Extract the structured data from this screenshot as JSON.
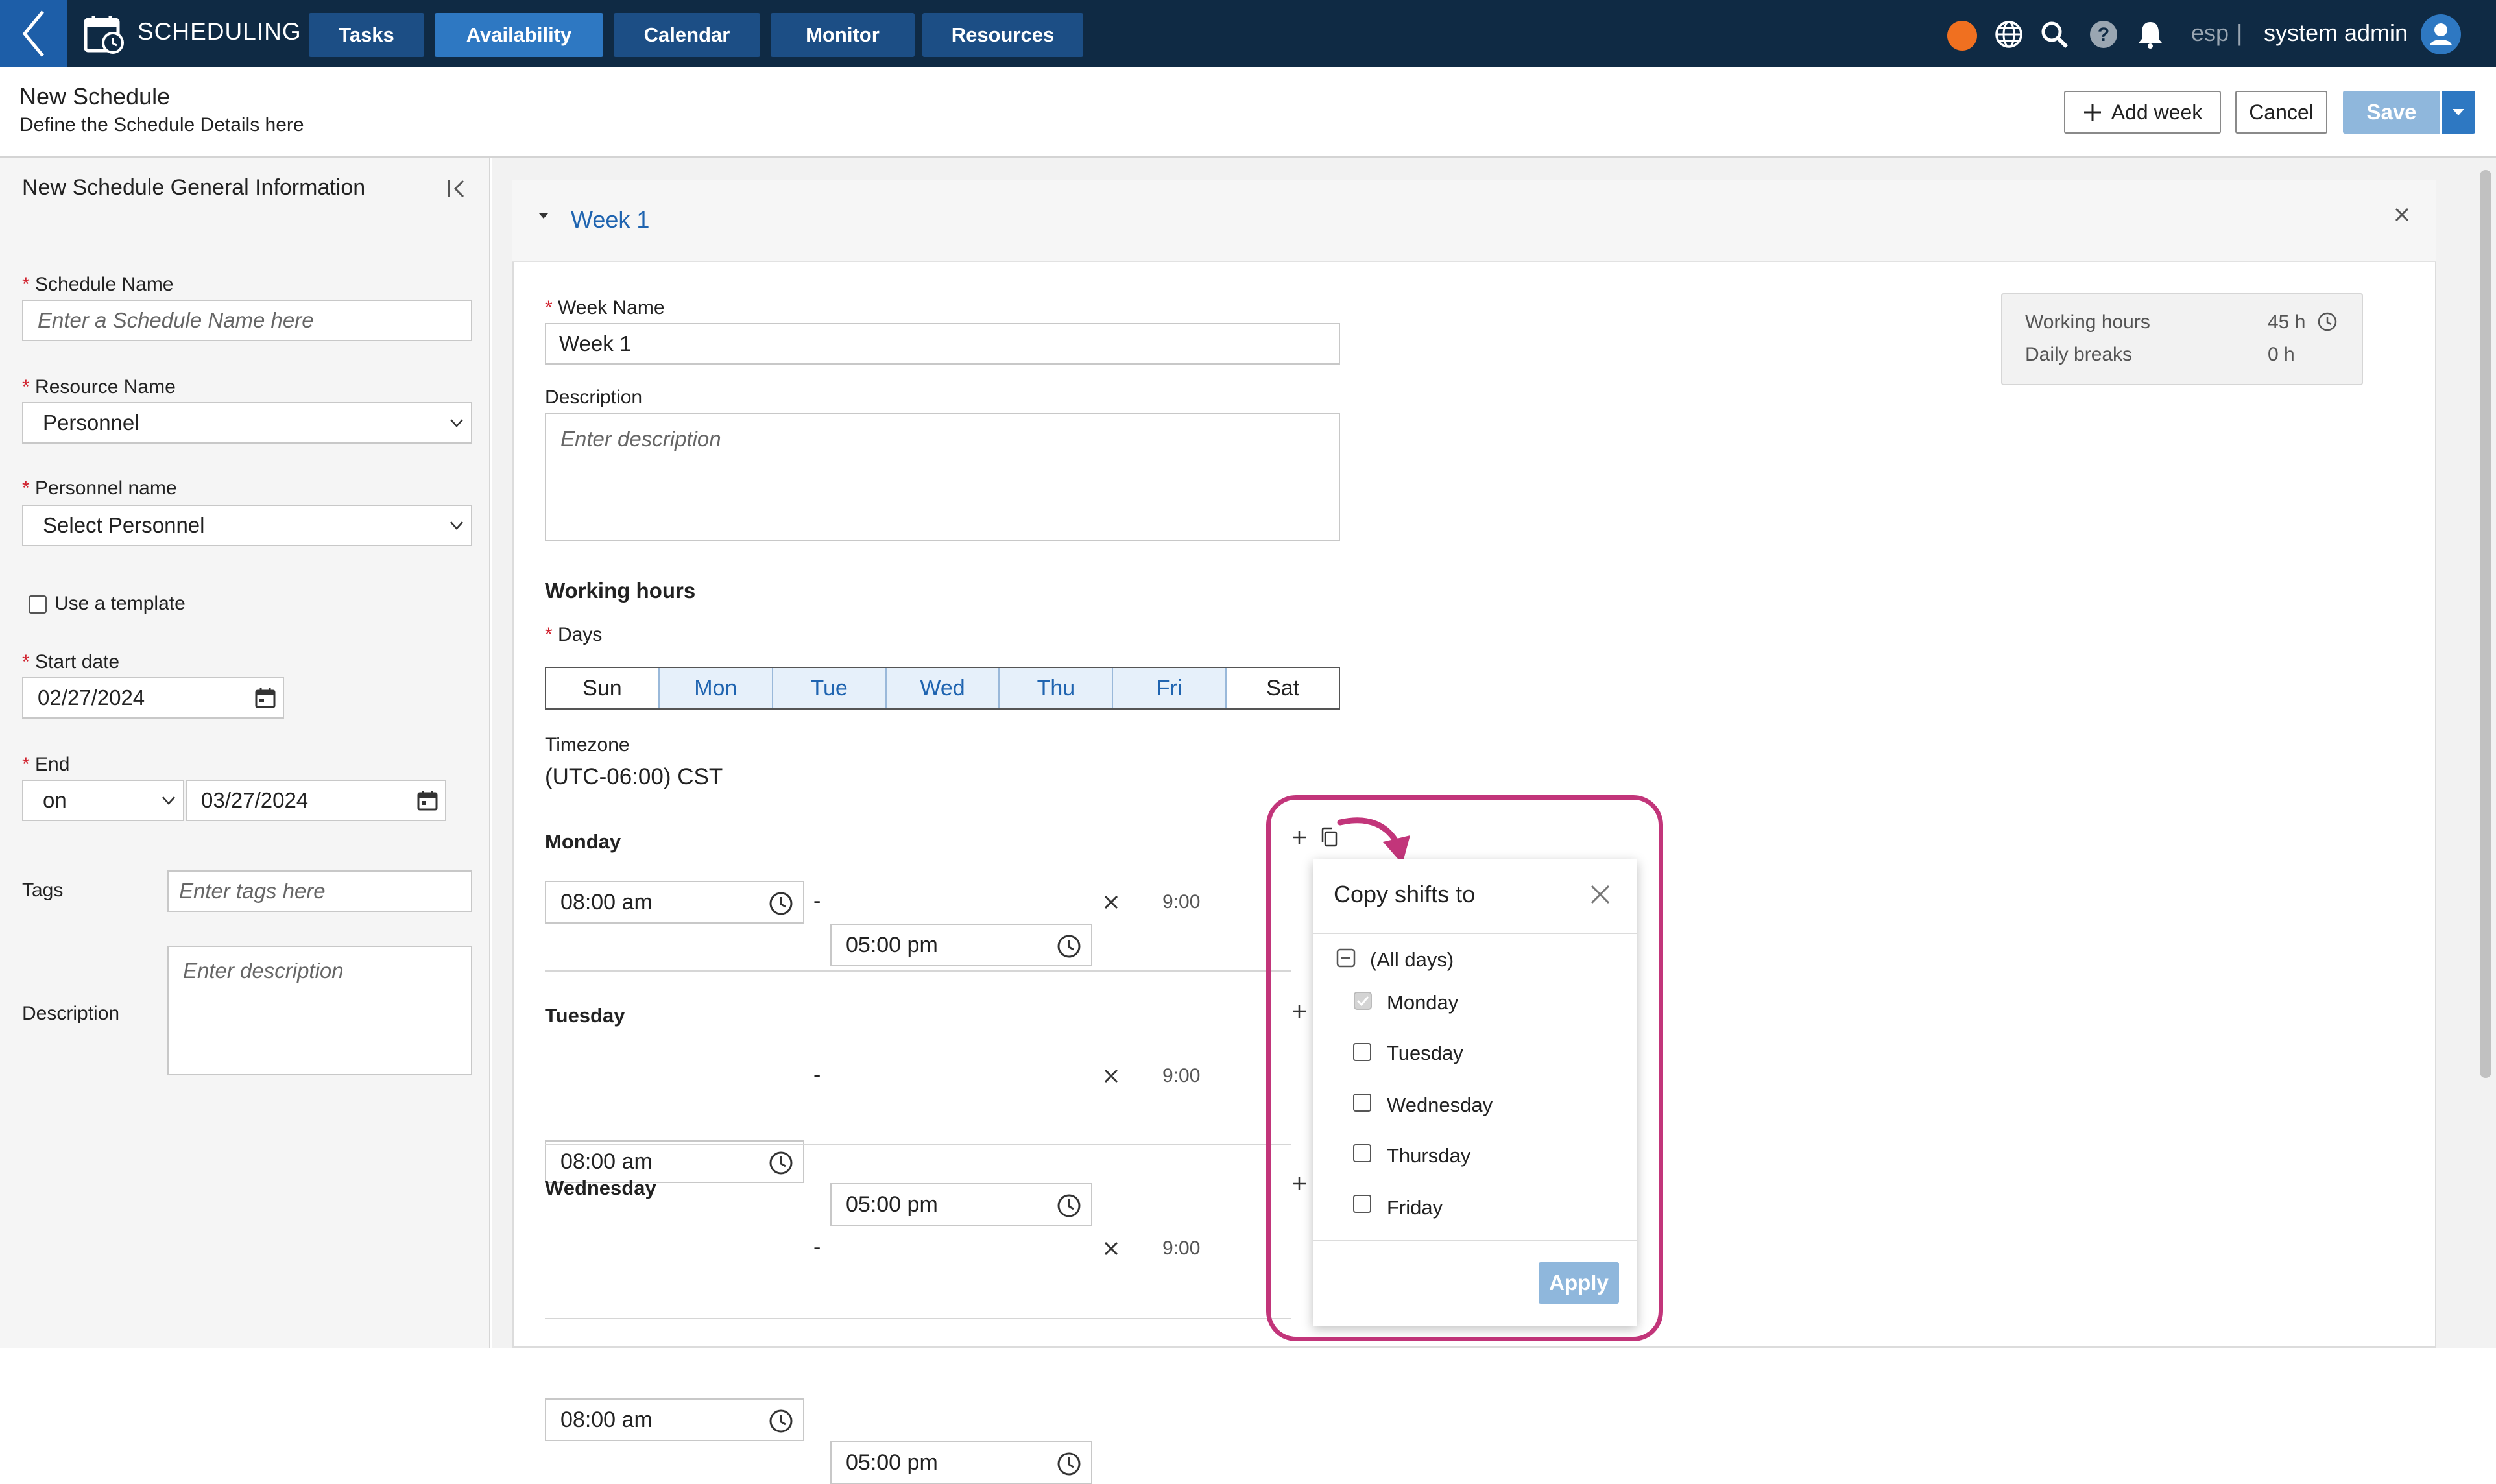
{
  "topbar": {
    "app_title": "SCHEDULING",
    "nav": [
      "Tasks",
      "Availability",
      "Calendar",
      "Monitor",
      "Resources"
    ],
    "active_nav": "Availability",
    "language": "esp",
    "separator": "|",
    "user": "system admin"
  },
  "header": {
    "title": "New Schedule",
    "subtitle": "Define the Schedule Details here",
    "add_week": "Add week",
    "cancel": "Cancel",
    "save": "Save"
  },
  "left": {
    "title": "New Schedule General Information",
    "req_mark": "*",
    "schedule_name_label": "Schedule Name",
    "schedule_name_placeholder": "Enter a Schedule Name here",
    "resource_name_label": "Resource Name",
    "resource_name_value": "Personnel",
    "personnel_label": "Personnel name",
    "personnel_value": "Select Personnel",
    "template_label": "Use a template",
    "start_label": "Start date",
    "start_value": "02/27/2024",
    "end_label": "End",
    "end_mode": "on",
    "end_value": "03/27/2024",
    "tags_label": "Tags",
    "tags_placeholder": "Enter tags here",
    "desc_label": "Description",
    "desc_placeholder": "Enter description"
  },
  "week": {
    "title": "Week 1",
    "name_label": "Week Name",
    "name_value": "Week 1",
    "desc_label": "Description",
    "desc_placeholder": "Enter description",
    "working_hours_title": "Working hours",
    "days_label": "Days",
    "days": [
      {
        "label": "Sun",
        "selected": false
      },
      {
        "label": "Mon",
        "selected": true
      },
      {
        "label": "Tue",
        "selected": true
      },
      {
        "label": "Wed",
        "selected": true
      },
      {
        "label": "Thu",
        "selected": true
      },
      {
        "label": "Fri",
        "selected": true
      },
      {
        "label": "Sat",
        "selected": false
      }
    ],
    "timezone_label": "Timezone",
    "timezone_value": "(UTC-06:00) CST",
    "summary": {
      "working_hours_label": "Working hours",
      "working_hours_value": "45 h",
      "daily_breaks_label": "Daily breaks",
      "daily_breaks_value": "0 h"
    },
    "shifts": [
      {
        "day": "Monday",
        "start": "08:00 am",
        "end": "05:00 pm",
        "duration": "9:00"
      },
      {
        "day": "Tuesday",
        "start": "08:00 am",
        "end": "05:00 pm",
        "duration": "9:00"
      },
      {
        "day": "Wednesday",
        "start": "08:00 am",
        "end": "05:00 pm",
        "duration": "9:00"
      }
    ],
    "range_sep": "-"
  },
  "popup": {
    "title": "Copy shifts to",
    "all_days": "(All days)",
    "items": [
      {
        "label": "Monday",
        "checked": true,
        "disabled": true
      },
      {
        "label": "Tuesday",
        "checked": false
      },
      {
        "label": "Wednesday",
        "checked": false
      },
      {
        "label": "Thursday",
        "checked": false
      },
      {
        "label": "Friday",
        "checked": false
      }
    ],
    "apply": "Apply"
  },
  "colors": {
    "topbar": "#0f2a44",
    "nav_button": "#1c4e85",
    "nav_active": "#2e78c2",
    "accent_text": "#1f64b0",
    "required": "#d0212d",
    "highlight": "#c2357a",
    "status_dot": "#f07020",
    "disabled_button": "#8fb7dc"
  }
}
